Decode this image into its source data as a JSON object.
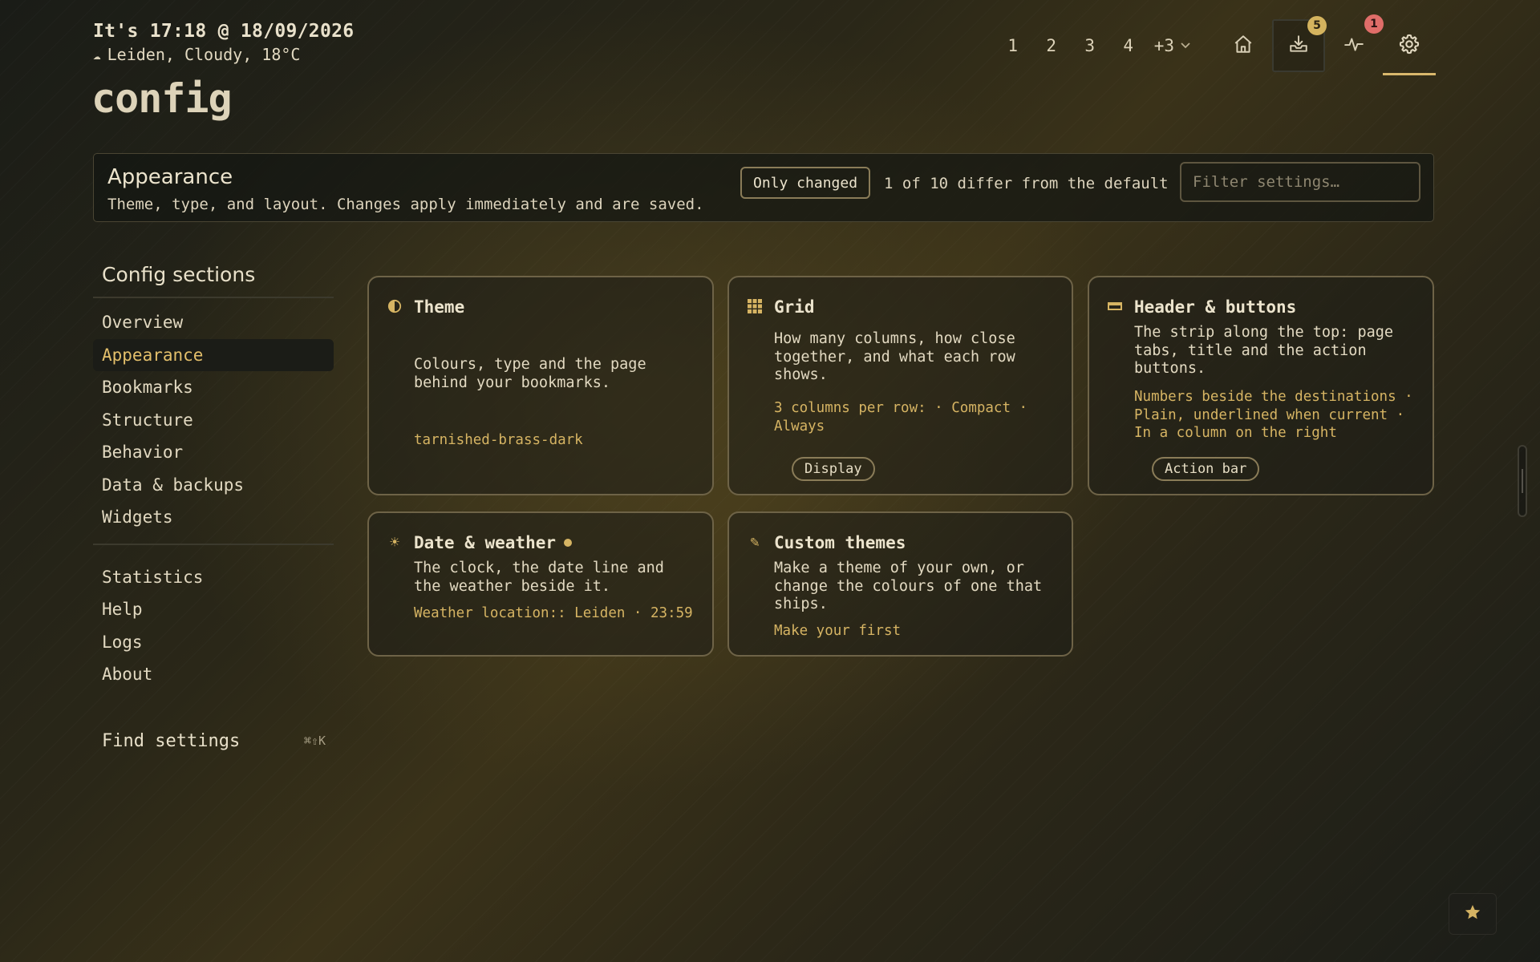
{
  "header": {
    "clock": "It's 17:18 @ 18/09/2026",
    "weather": "Leiden, Cloudy, 18°C",
    "weather_icon": "cloud-icon",
    "page_title": "config"
  },
  "topnav": {
    "tabs": [
      "1",
      "2",
      "3",
      "4"
    ],
    "more_label": "+3",
    "downloads_badge": "5",
    "activity_badge": "1",
    "icons": [
      "home-icon",
      "download-icon",
      "activity-icon",
      "gear-icon"
    ]
  },
  "appbar": {
    "title": "Appearance",
    "description": "Theme, type, and layout. Changes apply immediately and are saved.",
    "only_changed_label": "Only changed",
    "differ_text": "1 of 10 differ from the default",
    "filter_placeholder": "Filter settings…"
  },
  "sidebar": {
    "title": "Config sections",
    "items": [
      "Overview",
      "Appearance",
      "Bookmarks",
      "Structure",
      "Behavior",
      "Data & backups",
      "Widgets"
    ],
    "active": "Appearance",
    "secondary_items": [
      "Statistics",
      "Help",
      "Logs",
      "About"
    ],
    "find_label": "Find settings",
    "find_shortcut": "⌘⇧K"
  },
  "cards": {
    "theme": {
      "title": "Theme",
      "description": "Colours, type and the page behind your bookmarks.",
      "value": "tarnished-brass-dark"
    },
    "grid": {
      "title": "Grid",
      "description": "How many columns, how close together, and what each row shows.",
      "value": "3 columns per row: · Compact · Always",
      "chip": "Display"
    },
    "header_buttons": {
      "title": "Header & buttons",
      "description": "The strip along the top: page tabs, title and the action buttons.",
      "value": "Numbers beside the destinations · Plain, underlined when current · In a column on the right",
      "chip": "Action bar"
    },
    "date_weather": {
      "title": "Date & weather",
      "description": "The clock, the date line and the weather beside it.",
      "value": "Weather location:: Leiden · 23:59",
      "changed": true
    },
    "custom_themes": {
      "title": "Custom themes",
      "description": "Make a theme of your own, or change the colours of one that ships.",
      "value": "Make your first"
    }
  },
  "colors": {
    "accent": "#d6b463",
    "active_text": "#e3bf6b",
    "badge_gold": "#d4b35e",
    "badge_red": "#e06d69"
  }
}
